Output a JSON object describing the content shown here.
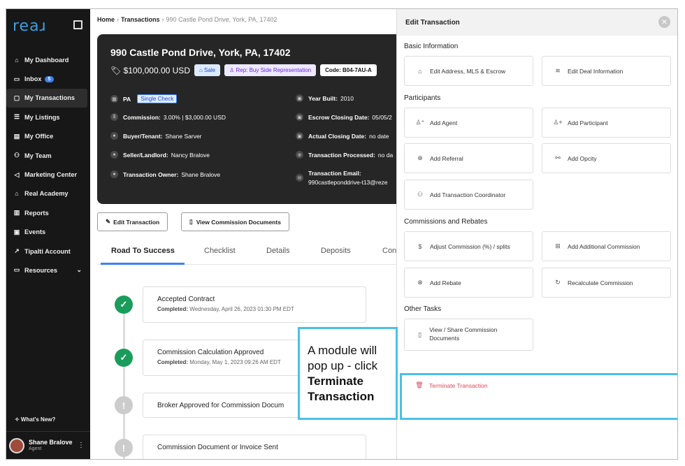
{
  "sidebar": {
    "logo": "reaɹ",
    "items": [
      {
        "icon": "home-icon",
        "glyph": "⌂",
        "label": "My Dashboard"
      },
      {
        "icon": "inbox-icon",
        "glyph": "▭",
        "label": "Inbox",
        "badge": "5"
      },
      {
        "icon": "transactions-icon",
        "glyph": "▢",
        "label": "My Transactions",
        "active": true
      },
      {
        "icon": "listings-icon",
        "glyph": "☰",
        "label": "My Listings"
      },
      {
        "icon": "office-icon",
        "glyph": "▤",
        "label": "My Office"
      },
      {
        "icon": "team-icon",
        "glyph": "⚇",
        "label": "My Team"
      },
      {
        "icon": "megaphone-icon",
        "glyph": "◁",
        "label": "Marketing Center"
      },
      {
        "icon": "academy-icon",
        "glyph": "⌂",
        "label": "Real Academy"
      },
      {
        "icon": "reports-icon",
        "glyph": "▥",
        "label": "Reports"
      },
      {
        "icon": "calendar-icon",
        "glyph": "▣",
        "label": "Events"
      },
      {
        "icon": "external-link-icon",
        "glyph": "↗",
        "label": "Tipalti Account"
      },
      {
        "icon": "resources-icon",
        "glyph": "▭",
        "label": "Resources",
        "expand": "⌄"
      }
    ],
    "whats_new": "✧ What's New?",
    "user": {
      "name": "Shane Bralove",
      "role": "Agent"
    }
  },
  "breadcrumb": {
    "home": "Home",
    "section": "Transactions",
    "current": "990 Castle Pond Drive, York, PA, 17402"
  },
  "card": {
    "address": "990 Castle Pond Drive, York, PA, 17402",
    "price": "$100,000.00 USD",
    "sale_chip": "Sale",
    "rep_chip": "Rep: Buy Side Representation",
    "code_chip": "Code: B04-7AU-A",
    "state": "PA",
    "single_check": "Single Check",
    "commission_label": "Commission:",
    "commission_value": "3.00% | $3,000.00 USD",
    "buyer_label": "Buyer/Tenant:",
    "buyer_value": "Shane Sarver",
    "seller_label": "Seller/Landlord:",
    "seller_value": "Nancy Bralove",
    "owner_label": "Transaction Owner:",
    "owner_value": "Shane Bralove",
    "year_label": "Year Built:",
    "year_value": "2010",
    "escrow_label": "Escrow Closing Date:",
    "escrow_value": "05/05/2",
    "actual_label": "Actual Closing Date:",
    "actual_value": "no date",
    "processed_label": "Transaction Processed:",
    "processed_value": "no da",
    "email_label": "Transaction Email:",
    "email_value": "990castleponddrive-t13@reze"
  },
  "actions": {
    "edit": "Edit Transaction",
    "view_docs": "View Commission Documents"
  },
  "tabs": [
    "Road To Success",
    "Checklist",
    "Details",
    "Deposits",
    "Con"
  ],
  "steps": [
    {
      "title": "Accepted Contract",
      "sub_label": "Completed:",
      "sub_value": "Wednesday, April 26, 2023 01:30 PM EDT",
      "status": "done"
    },
    {
      "title": "Commission Calculation Approved",
      "sub_label": "Completed:",
      "sub_value": "Monday, May 1, 2023 09:26 AM EDT",
      "status": "done"
    },
    {
      "title": "Broker Approved for Commission Docum",
      "status": "todo"
    },
    {
      "title": "Commission Document or Invoice Sent",
      "status": "todo"
    }
  ],
  "panel": {
    "title": "Edit Transaction",
    "sections": {
      "basic": "Basic Information",
      "participants": "Participants",
      "commissions": "Commissions and Rebates",
      "other": "Other Tasks"
    },
    "options": {
      "edit_address": "Edit Address, MLS & Escrow",
      "edit_deal": "Edit Deal Information",
      "add_agent": "Add Agent",
      "add_participant": "Add Participant",
      "add_referral": "Add Referral",
      "add_opcity": "Add Opcity",
      "add_coordinator": "Add Transaction Coordinator",
      "adjust_commission": "Adjust Commission (%) / splits",
      "add_additional": "Add Additional Commission",
      "add_rebate": "Add Rebate",
      "recalculate": "Recalculate Commission",
      "view_share": "View / Share Commission Documents",
      "terminate": "Terminate Transaction"
    }
  },
  "callout": {
    "text": "A module will pop up - click",
    "bold": "Terminate Transaction"
  },
  "colors": {
    "accent": "#3b82f6",
    "highlight": "#4cc0e6",
    "danger": "#e0445a",
    "success": "#1a9d5a"
  }
}
